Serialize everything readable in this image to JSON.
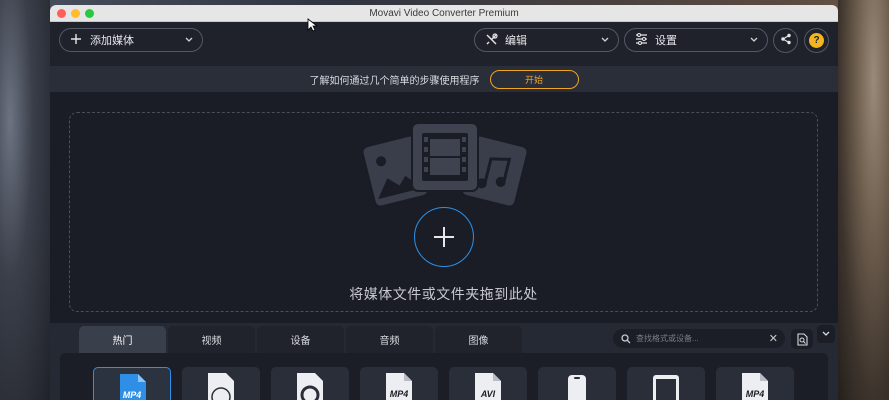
{
  "window": {
    "title": "Movavi Video Converter Premium"
  },
  "toolbar": {
    "add_media_label": "添加媒体",
    "edit_label": "编辑",
    "settings_label": "设置"
  },
  "banner": {
    "text": "了解如何通过几个简单的步骤使用程序",
    "start_label": "开始"
  },
  "dropzone": {
    "text": "将媒体文件或文件夹拖到此处"
  },
  "format_tabs": [
    {
      "label": "热门",
      "active": true
    },
    {
      "label": "视频",
      "active": false
    },
    {
      "label": "设备",
      "active": false
    },
    {
      "label": "音频",
      "active": false
    },
    {
      "label": "图像",
      "active": false
    }
  ],
  "search": {
    "placeholder": "查找格式或设备..."
  },
  "format_tiles": [
    {
      "label": "MP4",
      "icon": "file-video-icon"
    },
    {
      "label": "",
      "icon": "disc-icon"
    },
    {
      "label": "",
      "icon": "quicktime-icon"
    },
    {
      "label": "MP4",
      "icon": "file-icon"
    },
    {
      "label": "AVI",
      "icon": "file-icon"
    },
    {
      "label": "",
      "icon": "phone-icon"
    },
    {
      "label": "",
      "icon": "ipad-icon"
    },
    {
      "label": "MP4",
      "icon": "file-icon"
    }
  ],
  "colors": {
    "accent": "#2f8fe6",
    "banner_button": "#f2a51f",
    "help": "#f4b520"
  }
}
